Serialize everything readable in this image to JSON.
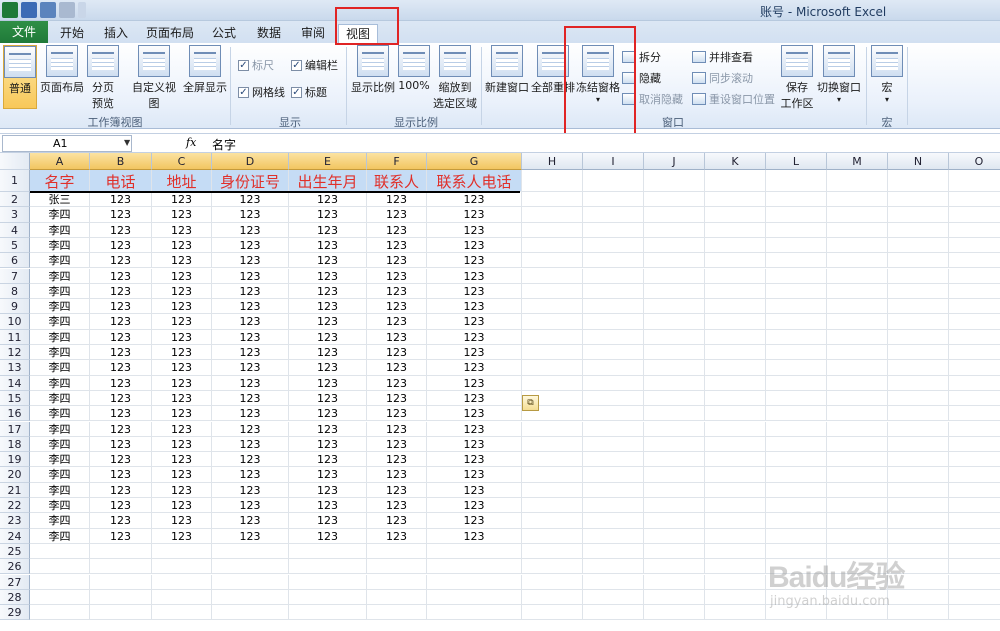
{
  "app_title": "账号 - Microsoft Excel",
  "tabs": [
    "文件",
    "开始",
    "插入",
    "页面布局",
    "公式",
    "数据",
    "审阅",
    "视图"
  ],
  "ribbon": {
    "workbook_views": {
      "label": "工作簿视图",
      "normal": "普通",
      "page_layout": "页面布局",
      "page_break_1": "分页",
      "page_break_2": "预览",
      "custom_views": "自定义视图",
      "full_screen": "全屏显示"
    },
    "show": {
      "label": "显示",
      "ruler": "标尺",
      "formula_bar": "编辑栏",
      "gridlines": "网格线",
      "headings": "标题"
    },
    "zoom": {
      "label": "显示比例",
      "zoom": "显示比例",
      "zoom_100": "100%",
      "zoom_selection_1": "缩放到",
      "zoom_selection_2": "选定区域"
    },
    "window": {
      "label": "窗口",
      "new_window": "新建窗口",
      "arrange_all": "全部重排",
      "freeze_panes": "冻结窗格",
      "split": "拆分",
      "hide": "隐藏",
      "unhide": "取消隐藏",
      "side_by_side": "并排查看",
      "sync_scroll": "同步滚动",
      "reset_position": "重设窗口位置",
      "save_workspace_1": "保存",
      "save_workspace_2": "工作区",
      "switch_windows": "切换窗口"
    },
    "macros": {
      "label": "宏",
      "macros": "宏"
    }
  },
  "formula_bar": {
    "name_box": "A1",
    "fx": "fx",
    "content": "名字"
  },
  "columns": [
    "A",
    "B",
    "C",
    "D",
    "E",
    "F",
    "G",
    "H",
    "I",
    "J",
    "K",
    "L",
    "M",
    "N",
    "O"
  ],
  "header_row": [
    "名字",
    "电话",
    "地址",
    "身份证号",
    "出生年月",
    "联系人",
    "联系人电话"
  ],
  "data_rows": [
    [
      "张三",
      "123",
      "123",
      "123",
      "123",
      "123",
      "123"
    ],
    [
      "李四",
      "123",
      "123",
      "123",
      "123",
      "123",
      "123"
    ],
    [
      "李四",
      "123",
      "123",
      "123",
      "123",
      "123",
      "123"
    ],
    [
      "李四",
      "123",
      "123",
      "123",
      "123",
      "123",
      "123"
    ],
    [
      "李四",
      "123",
      "123",
      "123",
      "123",
      "123",
      "123"
    ],
    [
      "李四",
      "123",
      "123",
      "123",
      "123",
      "123",
      "123"
    ],
    [
      "李四",
      "123",
      "123",
      "123",
      "123",
      "123",
      "123"
    ],
    [
      "李四",
      "123",
      "123",
      "123",
      "123",
      "123",
      "123"
    ],
    [
      "李四",
      "123",
      "123",
      "123",
      "123",
      "123",
      "123"
    ],
    [
      "李四",
      "123",
      "123",
      "123",
      "123",
      "123",
      "123"
    ],
    [
      "李四",
      "123",
      "123",
      "123",
      "123",
      "123",
      "123"
    ],
    [
      "李四",
      "123",
      "123",
      "123",
      "123",
      "123",
      "123"
    ],
    [
      "李四",
      "123",
      "123",
      "123",
      "123",
      "123",
      "123"
    ],
    [
      "李四",
      "123",
      "123",
      "123",
      "123",
      "123",
      "123"
    ],
    [
      "李四",
      "123",
      "123",
      "123",
      "123",
      "123",
      "123"
    ],
    [
      "李四",
      "123",
      "123",
      "123",
      "123",
      "123",
      "123"
    ],
    [
      "李四",
      "123",
      "123",
      "123",
      "123",
      "123",
      "123"
    ],
    [
      "李四",
      "123",
      "123",
      "123",
      "123",
      "123",
      "123"
    ],
    [
      "李四",
      "123",
      "123",
      "123",
      "123",
      "123",
      "123"
    ],
    [
      "李四",
      "123",
      "123",
      "123",
      "123",
      "123",
      "123"
    ],
    [
      "李四",
      "123",
      "123",
      "123",
      "123",
      "123",
      "123"
    ],
    [
      "李四",
      "123",
      "123",
      "123",
      "123",
      "123",
      "123"
    ],
    [
      "李四",
      "123",
      "123",
      "123",
      "123",
      "123",
      "123"
    ]
  ],
  "row_numbers": [
    "1",
    "2",
    "3",
    "4",
    "5",
    "6",
    "7",
    "8",
    "9",
    "10",
    "11",
    "12",
    "13",
    "14",
    "15",
    "16",
    "17",
    "18",
    "19",
    "20",
    "21",
    "22",
    "23",
    "24",
    "25",
    "26",
    "27",
    "28",
    "29"
  ],
  "watermark": {
    "logo": "Baidu经验",
    "url": "jingyan.baidu.com"
  },
  "colors": {
    "file_tab": "#1f7a39",
    "header_text": "#e0302a",
    "header_fill": "#c5dcf5",
    "highlight": "#e02424"
  }
}
